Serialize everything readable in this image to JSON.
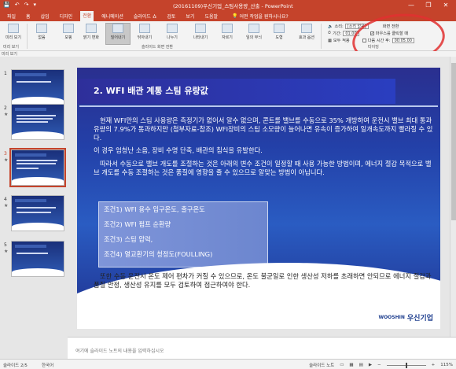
{
  "window": {
    "title": "(20161109)우신기업_스팀사용량_산출 - PowerPoint",
    "controls": [
      "—",
      "❐",
      "✕"
    ]
  },
  "quick_access": [
    "💾",
    "↶",
    "↷",
    "▾"
  ],
  "ribbon_tabs": [
    "파일",
    "홈",
    "삽입",
    "디자인",
    "전환",
    "애니메이션",
    "슬라이드 쇼",
    "검토",
    "보기",
    "도움말"
  ],
  "active_tab": "전환",
  "tell_me": "어떤 작업을 원하시나요?",
  "ribbon": {
    "preview": "미리 보기",
    "transitions": [
      "없음",
      "모핑",
      "밝기 변화",
      "밀어내기",
      "닦아내기",
      "나누기",
      "나타내기",
      "자르기",
      "임의 무늬",
      "도형"
    ],
    "selected_transition": "밀어내기",
    "effect_options": "효과 옵션",
    "group_labels": [
      "미리 보기",
      "슬라이드 화면 전환",
      "타이밍"
    ],
    "timing": {
      "sound_label": "소리:",
      "sound_value": "[소리 없음]",
      "duration_label": "기간:",
      "duration_value": "01.00",
      "apply_all": "모두 적용",
      "advance_title": "화면 전환",
      "on_click": "마우스를 클릭할 때",
      "after_label": "다음 시간 후:",
      "after_value": "00:05.00"
    }
  },
  "thumbnails": {
    "count": 5,
    "selected_index": 3,
    "numbers": [
      "1",
      "2",
      "3",
      "4",
      "5"
    ],
    "star": "★"
  },
  "slide": {
    "title": "2. WFI 배관 계통 스팀 유량값",
    "para1": "현재 WFI만의 스팀 사용량은 측정기가 없어서 알수 없으며, 콘트롤 밸브를 수동으로 35% 개방하여 운전시 밸브 최대 통과 유량의 7.9%가 통과하지만 (첨부자료-참조) WFI장비의 스팀 소모량이 늘어나면 유속이 증가하여 일개속도까지 빨라질 수 있다.",
    "para2": "이 경우 엄청난 소음, 장비 수명 단축, 배관의 침식을 유발한다.",
    "para3": "따라서 수동으로 밸브 개도를 조절하는 것은 아래의 변수 조건이 일정할 때 사용 가능한 방법이며, 에너지 절감 목적으로 밸브 개도를 수동 조절하는 것은 품질에 영향을 줄 수 있으므로 알맞는 방법이 아닙니다.",
    "conditions": [
      "조건1) WFI 용수 입구온도, 출구온도",
      "조건2) WFI 펌프 순환량",
      "조건3) 스팀 압력,",
      "조건4) 열교환기의 청정도(FOULLING)"
    ],
    "para4": "또한 수동 운전시 온도 제어 편차가 커질 수 있으므로, 온도 불균일로 인한 생산성 저하를 초래하면 안되므로 에너지 절감과 품질 안정, 생산성 유지를 모두 검토하여 접근하여야 한다.",
    "logo_en": "WOOSHIN",
    "logo_ko": "우신기업"
  },
  "notes_placeholder": "여기에 슬라이드 노트의 내용을 입력하십시오",
  "status": {
    "slide_info": "슬라이드 2/5",
    "language": "한국어",
    "notes_btn": "슬라이드 노트",
    "zoom": "115%"
  },
  "colors": {
    "accent": "#c5432b",
    "annotation": "#e03030"
  }
}
